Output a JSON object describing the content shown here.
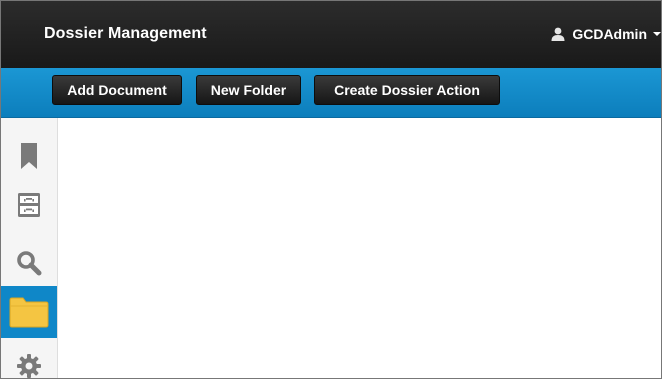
{
  "header": {
    "title": "Dossier Management",
    "user": {
      "name": "GCDAdmin",
      "icon": "user-icon"
    }
  },
  "toolbar": {
    "add_document_label": "Add Document",
    "new_folder_label": "New Folder",
    "create_dossier_action_label": "Create Dossier Action"
  },
  "sidebar": {
    "items": [
      {
        "icon": "bookmark-icon",
        "active": false
      },
      {
        "icon": "archive-cabinet-icon",
        "active": false
      },
      {
        "icon": "search-icon",
        "active": false
      },
      {
        "icon": "folder-icon",
        "active": true
      },
      {
        "icon": "gear-icon",
        "active": false
      }
    ]
  },
  "colors": {
    "header_bg": "#1f1f1f",
    "toolbar_bg": "#1392d0",
    "button_bg": "#222222",
    "active_nav_bg": "#0f87c8",
    "folder_yellow": "#f4c542",
    "icon_gray": "#777777"
  }
}
